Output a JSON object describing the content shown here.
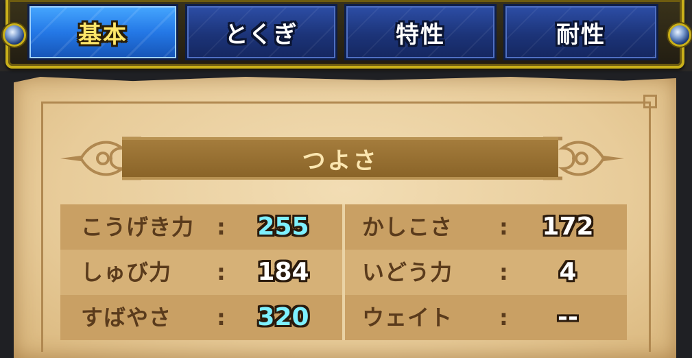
{
  "tabs": [
    {
      "label": "基本",
      "active": true
    },
    {
      "label": "とくぎ",
      "active": false
    },
    {
      "label": "特性",
      "active": false
    },
    {
      "label": "耐性",
      "active": false
    }
  ],
  "section": {
    "title": "つよさ"
  },
  "stats": {
    "left": [
      {
        "label": "こうげき力",
        "colon": ":",
        "value": "255",
        "boosted": true
      },
      {
        "label": "しゅび力",
        "colon": ":",
        "value": "184",
        "boosted": false
      },
      {
        "label": "すばやさ",
        "colon": ":",
        "value": "320",
        "boosted": true
      }
    ],
    "right": [
      {
        "label": "かしこさ",
        "colon": ":",
        "value": "172",
        "boosted": false
      },
      {
        "label": "いどう力",
        "colon": ":",
        "value": "4",
        "boosted": false
      },
      {
        "label": "ウェイト",
        "colon": ":",
        "value": "--",
        "boosted": false
      }
    ]
  },
  "colors": {
    "tab_active": "#2478e6",
    "tab_inactive": "#1c3479",
    "frame_gold": "#c9b01a",
    "boosted_value": "#7ef0ff",
    "normal_value": "#ffffff",
    "label_brown": "#5a3b1c"
  },
  "icons": {
    "tab_bar_left": "blue-orb-icon",
    "tab_bar_right": "blue-orb-icon",
    "header_ornament": "scroll-flourish-icon"
  }
}
